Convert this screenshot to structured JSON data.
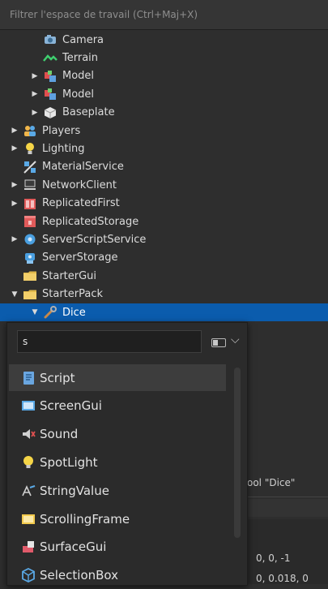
{
  "filter": {
    "placeholder": "Filtrer l'espace de travail (Ctrl+Maj+X)"
  },
  "explorer": {
    "items": [
      {
        "label": "Camera",
        "icon": "camera-icon",
        "indent": 2,
        "arrow": ""
      },
      {
        "label": "Terrain",
        "icon": "terrain-icon",
        "indent": 2,
        "arrow": ""
      },
      {
        "label": "Model",
        "icon": "model-icon",
        "indent": 2,
        "arrow": "▶"
      },
      {
        "label": "Model",
        "icon": "model-icon",
        "indent": 2,
        "arrow": "▶"
      },
      {
        "label": "Baseplate",
        "icon": "part-icon",
        "indent": 2,
        "arrow": "▶"
      },
      {
        "label": "Players",
        "icon": "players-icon",
        "indent": 1,
        "arrow": "▶"
      },
      {
        "label": "Lighting",
        "icon": "lighting-icon",
        "indent": 1,
        "arrow": "▶"
      },
      {
        "label": "MaterialService",
        "icon": "material-service-icon",
        "indent": 1,
        "arrow": ""
      },
      {
        "label": "NetworkClient",
        "icon": "network-client-icon",
        "indent": 1,
        "arrow": "▶"
      },
      {
        "label": "ReplicatedFirst",
        "icon": "replicated-first-icon",
        "indent": 1,
        "arrow": "▶"
      },
      {
        "label": "ReplicatedStorage",
        "icon": "replicated-storage-icon",
        "indent": 1,
        "arrow": ""
      },
      {
        "label": "ServerScriptService",
        "icon": "server-script-service-icon",
        "indent": 1,
        "arrow": "▶"
      },
      {
        "label": "ServerStorage",
        "icon": "server-storage-icon",
        "indent": 1,
        "arrow": ""
      },
      {
        "label": "StarterGui",
        "icon": "folder-icon",
        "indent": 1,
        "arrow": ""
      },
      {
        "label": "StarterPack",
        "icon": "folder-icon",
        "indent": 1,
        "arrow": "▼"
      },
      {
        "label": "Dice",
        "icon": "tool-icon",
        "indent": 2,
        "arrow": "▼",
        "selected": true
      }
    ]
  },
  "insert_popup": {
    "search_value": "s",
    "options": [
      {
        "label": "Script",
        "icon": "script-icon"
      },
      {
        "label": "ScreenGui",
        "icon": "screengui-icon"
      },
      {
        "label": "Sound",
        "icon": "sound-icon"
      },
      {
        "label": "SpotLight",
        "icon": "spotlight-icon"
      },
      {
        "label": "StringValue",
        "icon": "stringvalue-icon"
      },
      {
        "label": "ScrollingFrame",
        "icon": "scrollingframe-icon"
      },
      {
        "label": "SurfaceGui",
        "icon": "surfacegui-icon"
      },
      {
        "label": "SelectionBox",
        "icon": "selectionbox-icon"
      }
    ]
  },
  "properties": {
    "title_fragment": "ool \"Dice\"",
    "values": [
      "0, 0, -1",
      "0, 0.018, 0"
    ]
  }
}
